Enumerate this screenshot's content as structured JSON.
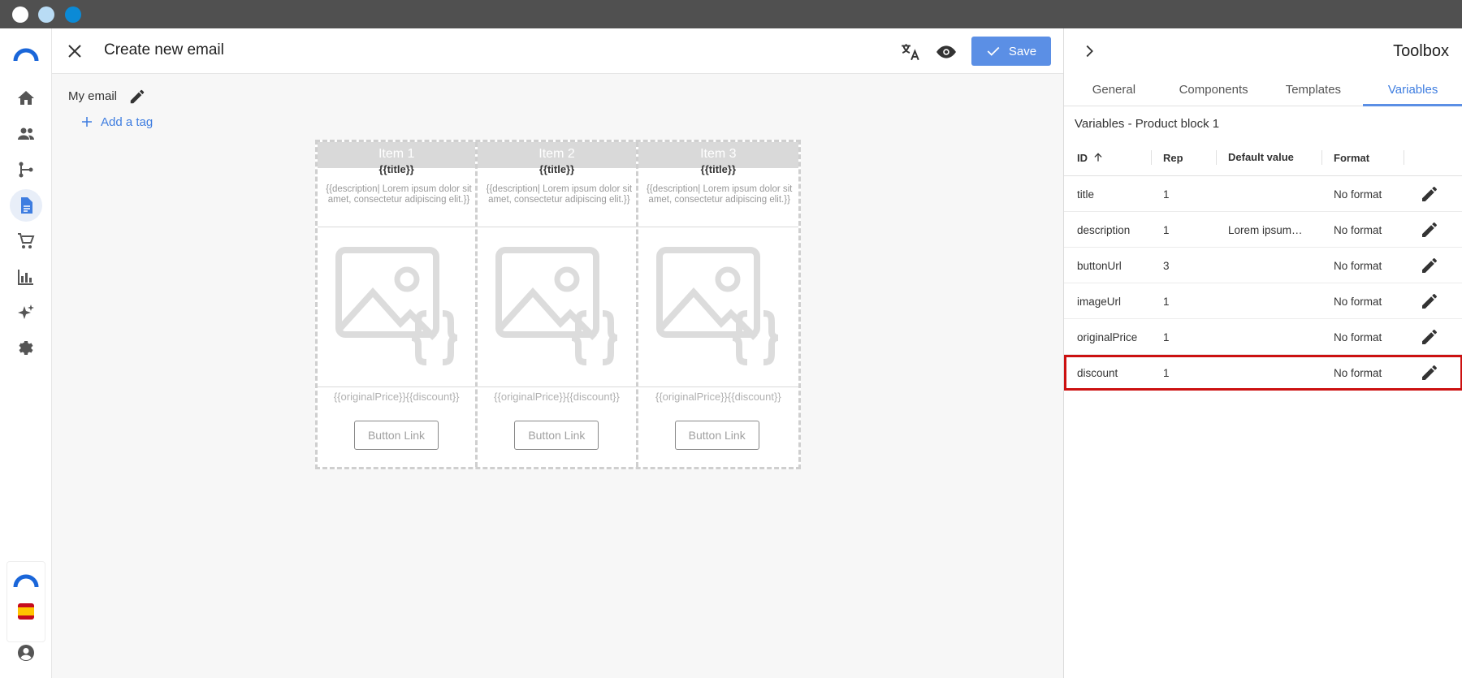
{
  "window": {
    "controls": [
      "close",
      "minimize",
      "maximize"
    ]
  },
  "rail": {
    "items": [
      {
        "name": "home-icon"
      },
      {
        "name": "people-icon"
      },
      {
        "name": "flow-icon"
      },
      {
        "name": "document-icon",
        "active": true
      },
      {
        "name": "cart-icon"
      },
      {
        "name": "chart-icon"
      },
      {
        "name": "sparkles-icon"
      },
      {
        "name": "gear-icon"
      }
    ]
  },
  "header": {
    "title": "Create new email",
    "save_label": "Save"
  },
  "editor": {
    "email_name": "My email",
    "add_tag_label": "Add a tag",
    "items": [
      {
        "header": "Item 1",
        "title": "{{title}}",
        "description": "{{description| Lorem ipsum dolor sit amet, consectetur adipiscing elit.}}",
        "price": "{{originalPrice}}{{discount}}",
        "button": "Button Link"
      },
      {
        "header": "Item 2",
        "title": "{{title}}",
        "description": "{{description| Lorem ipsum dolor sit amet, consectetur adipiscing elit.}}",
        "price": "{{originalPrice}}{{discount}}",
        "button": "Button Link"
      },
      {
        "header": "Item 3",
        "title": "{{title}}",
        "description": "{{description| Lorem ipsum dolor sit amet, consectetur adipiscing elit.}}",
        "price": "{{originalPrice}}{{discount}}",
        "button": "Button Link"
      }
    ]
  },
  "toolbox": {
    "title": "Toolbox",
    "tabs": [
      "General",
      "Components",
      "Templates",
      "Variables"
    ],
    "active_tab": "Variables",
    "heading": "Variables - Product block 1",
    "columns": {
      "id": "ID",
      "rep": "Rep",
      "default": "Default value",
      "format": "Format"
    },
    "rows": [
      {
        "id": "title",
        "rep": "1",
        "default": "",
        "format": "No format"
      },
      {
        "id": "description",
        "rep": "1",
        "default": "Lorem ipsum…",
        "format": "No format"
      },
      {
        "id": "buttonUrl",
        "rep": "3",
        "default": "",
        "format": "No format"
      },
      {
        "id": "imageUrl",
        "rep": "1",
        "default": "",
        "format": "No format"
      },
      {
        "id": "originalPrice",
        "rep": "1",
        "default": "",
        "format": "No format"
      },
      {
        "id": "discount",
        "rep": "1",
        "default": "",
        "format": "No format",
        "selected": true
      }
    ]
  },
  "colors": {
    "accent": "#5b8fe5",
    "link": "#3e7de0",
    "highlight": "#cc1111",
    "chrome": "#505050"
  }
}
